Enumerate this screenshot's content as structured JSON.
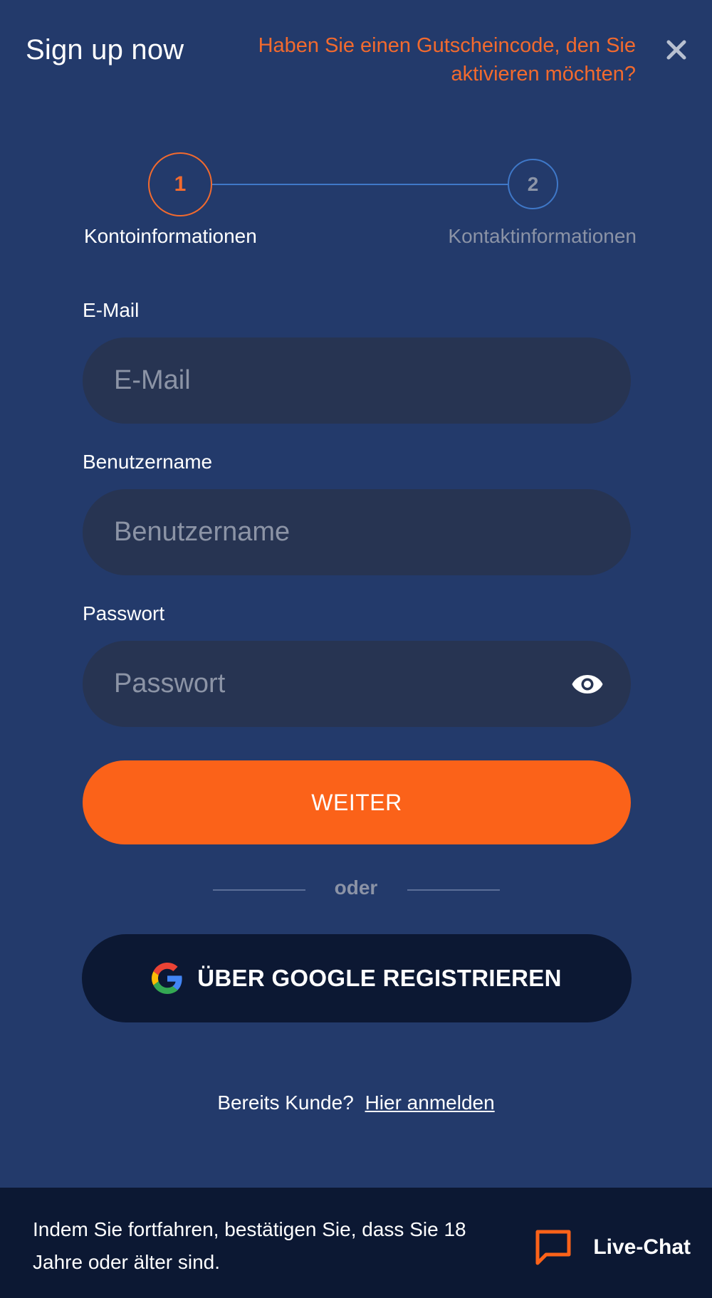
{
  "header": {
    "title": "Sign up now",
    "voucher_link": "Haben Sie einen Gutscheincode, den Sie aktivieren möchten?",
    "close_icon": "close-icon"
  },
  "stepper": {
    "steps": [
      {
        "number": "1",
        "label": "Kontoinformationen",
        "state": "active"
      },
      {
        "number": "2",
        "label": "Kontaktinformationen",
        "state": "inactive"
      }
    ]
  },
  "form": {
    "email": {
      "label": "E-Mail",
      "placeholder": "E-Mail",
      "value": ""
    },
    "username": {
      "label": "Benutzername",
      "placeholder": "Benutzername",
      "value": ""
    },
    "password": {
      "label": "Passwort",
      "placeholder": "Passwort",
      "value": "",
      "toggle_icon": "eye-icon"
    },
    "submit_label": "WEITER",
    "divider_text": "oder",
    "google_label": "ÜBER GOOGLE REGISTRIEREN",
    "google_icon": "google-icon"
  },
  "login": {
    "prompt": "Bereits Kunde?",
    "link": "Hier anmelden"
  },
  "footer": {
    "age_notice": "Indem Sie fortfahren, bestätigen Sie, dass Sie 18 Jahre oder älter sind.",
    "live_chat_label": "Live-Chat",
    "chat_icon": "chat-icon"
  },
  "colors": {
    "background": "#233a6b",
    "accent": "#fb6219",
    "link_orange": "#f26a2e",
    "input_bg": "#273452",
    "dark_panel": "#0c1833",
    "step_blue": "#3f78c8"
  }
}
